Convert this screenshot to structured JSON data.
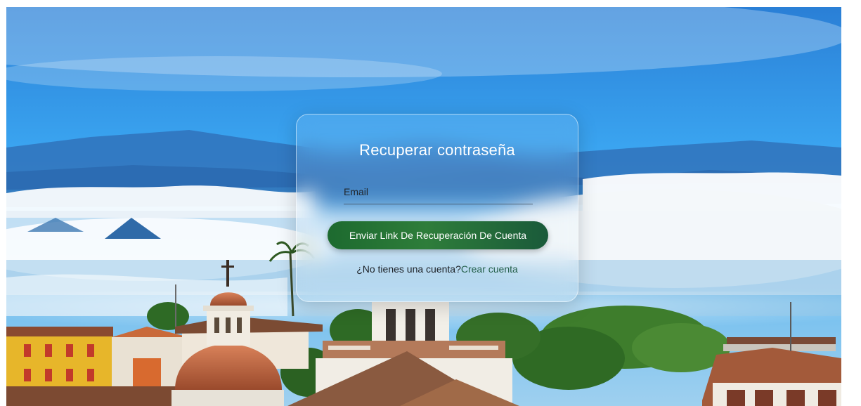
{
  "page": {
    "title": "Recuperar contraseña"
  },
  "form": {
    "email_placeholder": "Email",
    "email_value": "",
    "submit_label": "Enviar Link De Recuperación De Cuenta"
  },
  "signup": {
    "question": "¿No tienes una cuenta?",
    "link_label": "Crear cuenta"
  },
  "colors": {
    "button_green": "#2e7d3a",
    "link_green": "#245f4a",
    "sky_blue": "#1f8ee6"
  },
  "background": {
    "description_icon": "town-landscape-photo"
  }
}
